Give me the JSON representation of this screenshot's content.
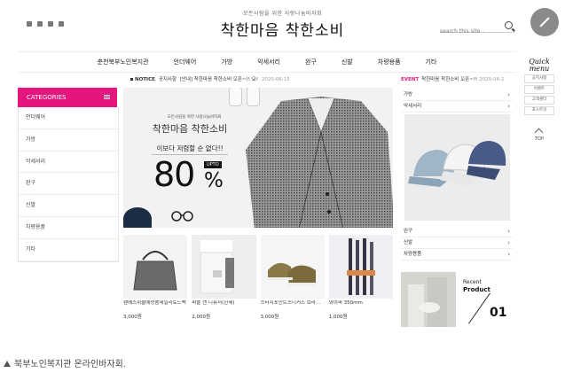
{
  "header": {
    "tagline": "모든사람을 위한 사랑나눔바자회",
    "logo": "착한마음 착한소비",
    "search_placeholder": "search this site .",
    "social_icons": [
      "facebook-icon",
      "twitter-icon",
      "youtube-icon",
      "blog-icon"
    ]
  },
  "nav": {
    "items": [
      "춘천북부노인복지관",
      "언더웨어",
      "가방",
      "악세서리",
      "완구",
      "신발",
      "차량용품",
      "기타"
    ]
  },
  "quick_menu": {
    "title_1": "Quick",
    "title_2": "menu",
    "items": [
      "공지사항",
      "이벤트",
      "고객센터",
      "포스트잇"
    ],
    "top_label": "TOP"
  },
  "sidebar": {
    "title": "CATEGORIES",
    "items": [
      "언더웨어",
      "가방",
      "악세서리",
      "완구",
      "신발",
      "차량용품",
      "기타"
    ]
  },
  "notice": {
    "label": "NOTICE",
    "category": "공지사항",
    "text": "[안내] 착한마음 착한소비 오픈~!! 요!",
    "date": "2020-06-15"
  },
  "banner": {
    "small_text": "모든사람을 위한 사랑나눔바자회",
    "title": "착한마음 착한소비",
    "subtitle": "이보다 저렴할 순 없다!!",
    "upto": "UPTO",
    "percent": "80",
    "percent_sign": "%"
  },
  "products": [
    {
      "name": "팬에스위블에성품데일리토드백",
      "price": "3,000원"
    },
    {
      "name": "퍼플 캔 디퓨저(한세)",
      "price": "2,000원"
    },
    {
      "name": "스타지포인트스니커즈 브라...",
      "price": "3,000원"
    },
    {
      "name": "와이퍼 350mm",
      "price": "1,000원"
    }
  ],
  "event": {
    "label": "EVENT",
    "text": "착한마음 착한소비 오픈~!!",
    "date": "2020-06-1"
  },
  "right_top_list": [
    "가방",
    "악세서리"
  ],
  "right_bottom_list": [
    "완구",
    "신발",
    "차량용품"
  ],
  "recent": {
    "label_1": "Recent",
    "label_2": "Product",
    "count": "01"
  },
  "caption": "북부노인복지관 온라인바자회."
}
